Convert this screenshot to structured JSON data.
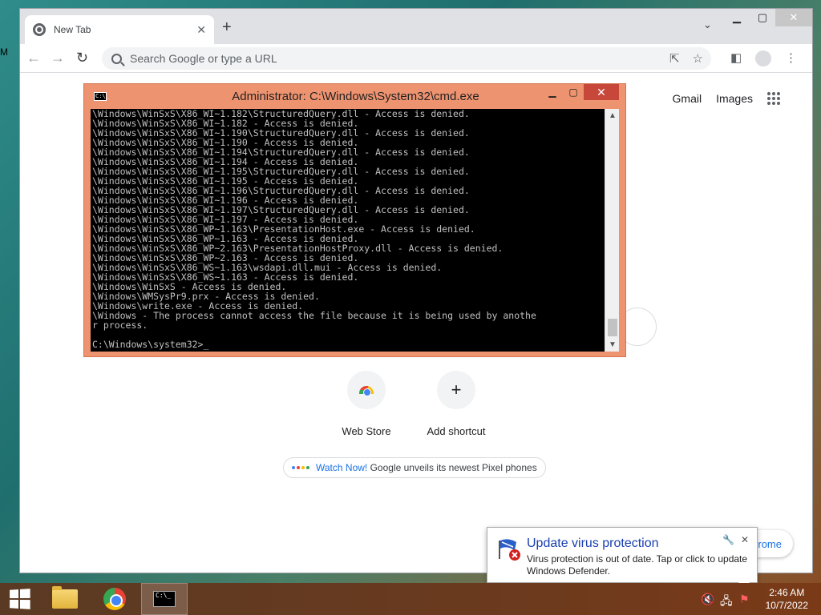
{
  "desktop": {
    "edge_text": "M"
  },
  "browser": {
    "tab_title": "New Tab",
    "omnibox_placeholder": "Search Google or type a URL",
    "ntp": {
      "gmail": "Gmail",
      "images": "Images",
      "shortcuts": [
        {
          "label": "Web Store"
        },
        {
          "label": "Add shortcut",
          "symbol": "+"
        }
      ],
      "promo": {
        "link": "Watch Now!",
        "text": " Google unveils its newest Pixel phones"
      },
      "customize_label": "rome"
    }
  },
  "cmd": {
    "title": "Administrator: C:\\Windows\\System32\\cmd.exe",
    "icon_text": "C:\\_",
    "lines": [
      "\\Windows\\WinSxS\\X86_WI~1.182\\StructuredQuery.dll - Access is denied.",
      "\\Windows\\WinSxS\\X86_WI~1.182 - Access is denied.",
      "\\Windows\\WinSxS\\X86_WI~1.190\\StructuredQuery.dll - Access is denied.",
      "\\Windows\\WinSxS\\X86_WI~1.190 - Access is denied.",
      "\\Windows\\WinSxS\\X86_WI~1.194\\StructuredQuery.dll - Access is denied.",
      "\\Windows\\WinSxS\\X86_WI~1.194 - Access is denied.",
      "\\Windows\\WinSxS\\X86_WI~1.195\\StructuredQuery.dll - Access is denied.",
      "\\Windows\\WinSxS\\X86_WI~1.195 - Access is denied.",
      "\\Windows\\WinSxS\\X86_WI~1.196\\StructuredQuery.dll - Access is denied.",
      "\\Windows\\WinSxS\\X86_WI~1.196 - Access is denied.",
      "\\Windows\\WinSxS\\X86_WI~1.197\\StructuredQuery.dll - Access is denied.",
      "\\Windows\\WinSxS\\X86_WI~1.197 - Access is denied.",
      "\\Windows\\WinSxS\\X86_WP~1.163\\PresentationHost.exe - Access is denied.",
      "\\Windows\\WinSxS\\X86_WP~1.163 - Access is denied.",
      "\\Windows\\WinSxS\\X86_WP~2.163\\PresentationHostProxy.dll - Access is denied.",
      "\\Windows\\WinSxS\\X86_WP~2.163 - Access is denied.",
      "\\Windows\\WinSxS\\X86_WS~1.163\\wsdapi.dll.mui - Access is denied.",
      "\\Windows\\WinSxS\\X86_WS~1.163 - Access is denied.",
      "\\Windows\\WinSxS - Access is denied.",
      "\\Windows\\WMSysPr9.prx - Access is denied.",
      "\\Windows\\write.exe - Access is denied.",
      "\\Windows - The process cannot access the file because it is being used by anothe",
      "r process.",
      "",
      "C:\\Windows\\system32>_"
    ]
  },
  "notification": {
    "title": "Update virus protection",
    "body": "Virus protection is out of date. Tap or click to update Windows Defender."
  },
  "taskbar": {
    "time": "2:46 AM",
    "date": "10/7/2022"
  }
}
